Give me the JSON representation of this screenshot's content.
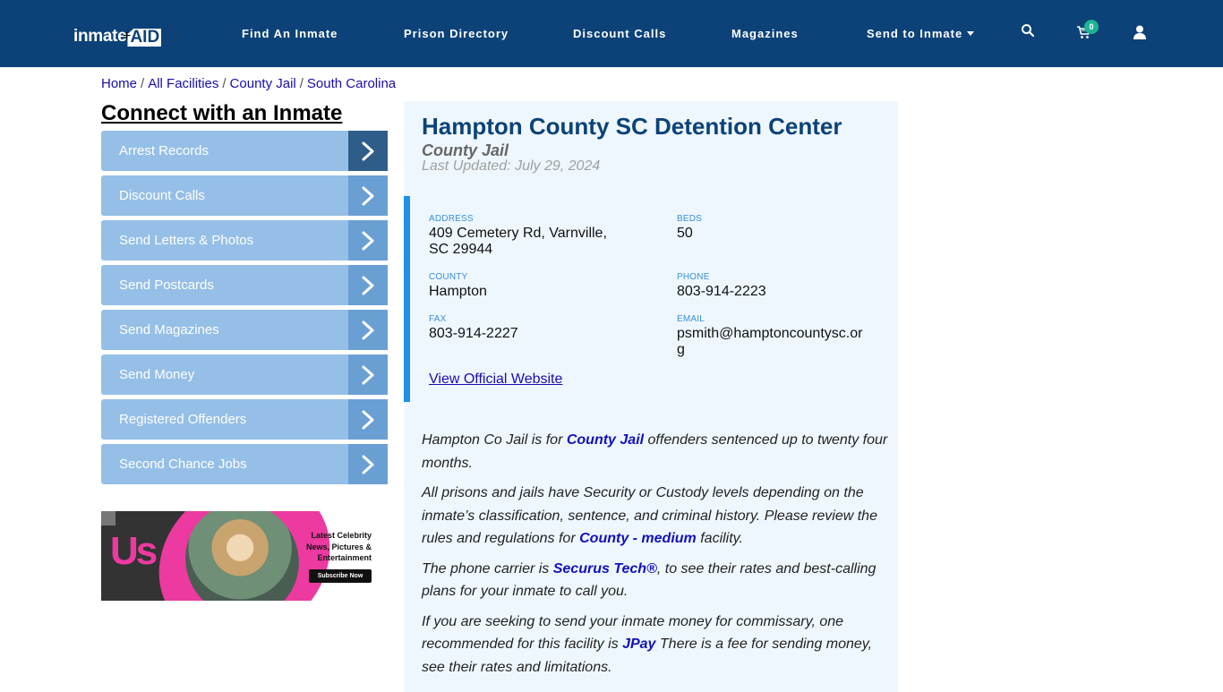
{
  "nav": {
    "logo_part1": "inmate",
    "logo_part2": "AID",
    "logo_plus": "+",
    "links": [
      {
        "label": "Find An Inmate"
      },
      {
        "label": "Prison Directory"
      },
      {
        "label": "Discount Calls"
      },
      {
        "label": "Magazines"
      },
      {
        "label": "Send to Inmate"
      }
    ],
    "icons": {
      "search": "search-icon",
      "cart": "cart-icon",
      "user": "user-icon"
    },
    "cart_count": "0"
  },
  "breadcrumb": [
    {
      "label": "Home"
    },
    {
      "label": "All Facilities"
    },
    {
      "label": "County Jail"
    },
    {
      "label": "South Carolina"
    }
  ],
  "breadcrumb_separator": "/",
  "sidebar": {
    "title": "Connect with an Inmate",
    "items": [
      {
        "label": "Arrest Records"
      },
      {
        "label": "Discount Calls"
      },
      {
        "label": "Send Letters & Photos"
      },
      {
        "label": "Send Postcards"
      },
      {
        "label": "Send Magazines"
      },
      {
        "label": "Send Money"
      },
      {
        "label": "Registered Offenders"
      },
      {
        "label": "Second Chance Jobs"
      }
    ],
    "ad": {
      "brand": "Us",
      "text": "Latest Celebrity News, Pictures & Entertainment",
      "button": "Subscribe Now"
    }
  },
  "facility": {
    "name": "Hampton County SC Detention Center",
    "type": "County Jail",
    "last_updated": "Last Updated: July 29, 2024",
    "fields": {
      "address": {
        "label": "ADDRESS",
        "value": "409 Cemetery Rd, Varnville, SC 29944"
      },
      "beds": {
        "label": "BEDS",
        "value": "50"
      },
      "county": {
        "label": "COUNTY",
        "value": "Hampton"
      },
      "phone": {
        "label": "PHONE",
        "value": "803-914-2223"
      },
      "fax": {
        "label": "FAX",
        "value": "803-914-2227"
      },
      "email": {
        "label": "EMAIL",
        "value": "psmith@hamptoncountysc.org"
      }
    },
    "official_link": "View Official Website",
    "description": {
      "p1": {
        "a": "Hampton Co Jail is for ",
        "link": "County Jail",
        "b": " offenders sentenced up to twenty four months."
      },
      "p2": {
        "a": "All prisons and jails have Security or Custody levels depending on the inmate’s classification, sentence, and criminal history. Please review the rules and regulations for ",
        "link": "County - medium",
        "b": " facility."
      },
      "p3": {
        "a": "The phone carrier is ",
        "link": "Securus Tech®",
        "b": ", to see their rates and best-calling plans for your inmate to call you."
      },
      "p4": {
        "a": "If you are seeking to send your inmate money for commissary, one recommended for this facility is ",
        "link": "JPay",
        "b": " There is a fee for sending money, see their rates and limitations."
      }
    }
  },
  "colors": {
    "nav_bg": "#0c4278",
    "sidebar_item": "#95bfe7",
    "sidebar_arrow": "#6a9fd4",
    "sidebar_arrow_active": "#2f5d8a",
    "card_bg": "#eef7fe",
    "accent_bar": "#1e90ea",
    "badge": "#1fb394"
  }
}
